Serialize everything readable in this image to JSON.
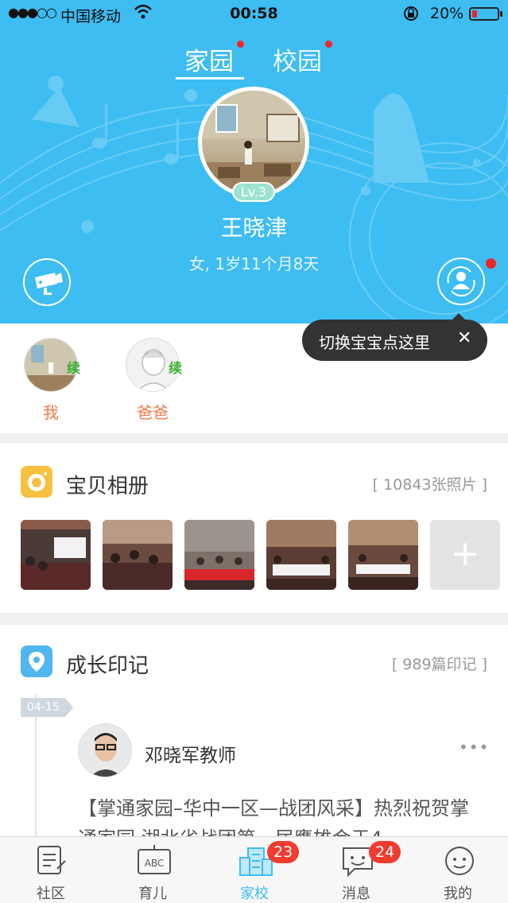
{
  "status_bar": {
    "signal": "●●●○○",
    "carrier": "中国移动",
    "time": "00:58",
    "battery_pct": "20%",
    "battery_level": 0.2
  },
  "header": {
    "tabs": [
      {
        "label": "家园",
        "active": true,
        "has_dot": true
      },
      {
        "label": "校园",
        "active": false,
        "has_dot": true
      }
    ],
    "level": "Lv.3",
    "child_name": "王晓津",
    "child_info": "女, 1岁11个月8天",
    "colors": {
      "background": "#3dbdf2",
      "badge_red": "#f0262a"
    }
  },
  "tooltip": {
    "text": "切换宝宝点这里",
    "close": "✕"
  },
  "family": {
    "members": [
      {
        "name": "我",
        "tag": "续"
      },
      {
        "name": "爸爸",
        "tag": "续"
      }
    ]
  },
  "album": {
    "title": "宝贝相册",
    "count": "[ 10843张照片 ]",
    "add_label": "+"
  },
  "growth": {
    "title": "成长印记",
    "count": "[ 989篇印记 ]",
    "date": "04-15",
    "author": "邓晓军教师",
    "more": "•••",
    "text": "【掌通家园–华中一区—战团风采】热烈祝贺掌通家园·湖北省战团第一届鹰雄会于4"
  },
  "tabbar": {
    "items": [
      {
        "label": "社区",
        "icon": "community-icon"
      },
      {
        "label": "育儿",
        "icon": "abc-board-icon"
      },
      {
        "label": "家校",
        "icon": "school-building-icon",
        "badge": "23",
        "active": true
      },
      {
        "label": "消息",
        "icon": "chat-bubble-icon",
        "badge": "24"
      },
      {
        "label": "我的",
        "icon": "profile-face-icon"
      }
    ]
  }
}
